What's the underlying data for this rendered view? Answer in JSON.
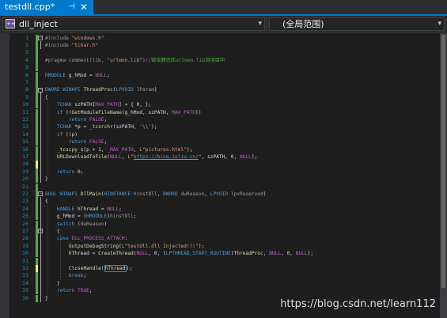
{
  "tab": {
    "title": "testdll.cpp*",
    "pin_icon": "pin-icon",
    "close_icon": "close-icon"
  },
  "nav": {
    "scope": "dll_inject",
    "member": "(全局范围)",
    "dropdown_icon": "chevron-down-icon"
  },
  "line_numbers": [
    "1",
    "2",
    "3",
    "4",
    "5",
    "6",
    "7",
    "8",
    "9",
    "10",
    "11",
    "12",
    "13",
    "14",
    "15",
    "16",
    "17",
    "18",
    "19",
    "20",
    "21",
    "22",
    "23",
    "24",
    "25",
    "26",
    "27",
    "28",
    "29",
    "30",
    "31",
    "32",
    "33",
    "34",
    "35",
    "36"
  ],
  "code": [
    "#include \"windows.h\"",
    "#include \"tchar.h\"",
    "",
    "#pragma comment(lib, \"urlmon.lib\")//链接静态库urlmon.lib到项目中",
    "",
    "HMODULE g_hMod = NULL;",
    "",
    "DWORD WINAPI ThreadProc(LPVOID lParam)",
    "{",
    "    TCHAR szPATH[MAX_PATH] = { 0, };",
    "    if (!GetModuleFileName(g_hMod, szPATH, MAX_PATH))",
    "        return FALSE;",
    "    TCHAR *p = _tcsrchr(szPATH, '\\\\');",
    "    if (!p)",
    "        return FALSE;",
    "    _tcscpy_s(p + 1, _MAX_PATH, L\"pictures.html\");",
    "    URLDownloadToFile(NULL, L\"https://bing.ioliu.cn/\", szPATH, 0, NULL);",
    "",
    "    return 0;",
    "}",
    "",
    "BOOL WINAPI DllMain(HINSTANCE hinstDll, DWORD dwReason, LPVOID lpvReserved)",
    "{",
    "    HANDLE hThread = NULL;",
    "    g_hMod = (HMODULE)hinstDll;",
    "    switch (dwReason)",
    "    {",
    "    case DLL_PROCESS_ATTACH:",
    "        OutputDebugString(L\"testdll.dll Injected!!!\");",
    "        hThread = CreateThread(NULL, 0, (LPTHREAD_START_ROUTINE)ThreadProc, NULL, 0, NULL);",
    "",
    "        CloseHandle(hThread);",
    "        break;",
    "    }",
    "    return TRUE;",
    "}"
  ],
  "watermark": "https://blog.csdn.net/learn112",
  "colors": {
    "accent": "#007acc",
    "line_number": "#2b91af",
    "keyword": "#569cd6",
    "macro": "#bd63c5",
    "string": "#d69d85",
    "comment": "#57a64a",
    "type": "#4ec9b0",
    "function": "#dcdcaa",
    "modified_yellow": "#efef6e",
    "saved_green": "#57a64a"
  }
}
